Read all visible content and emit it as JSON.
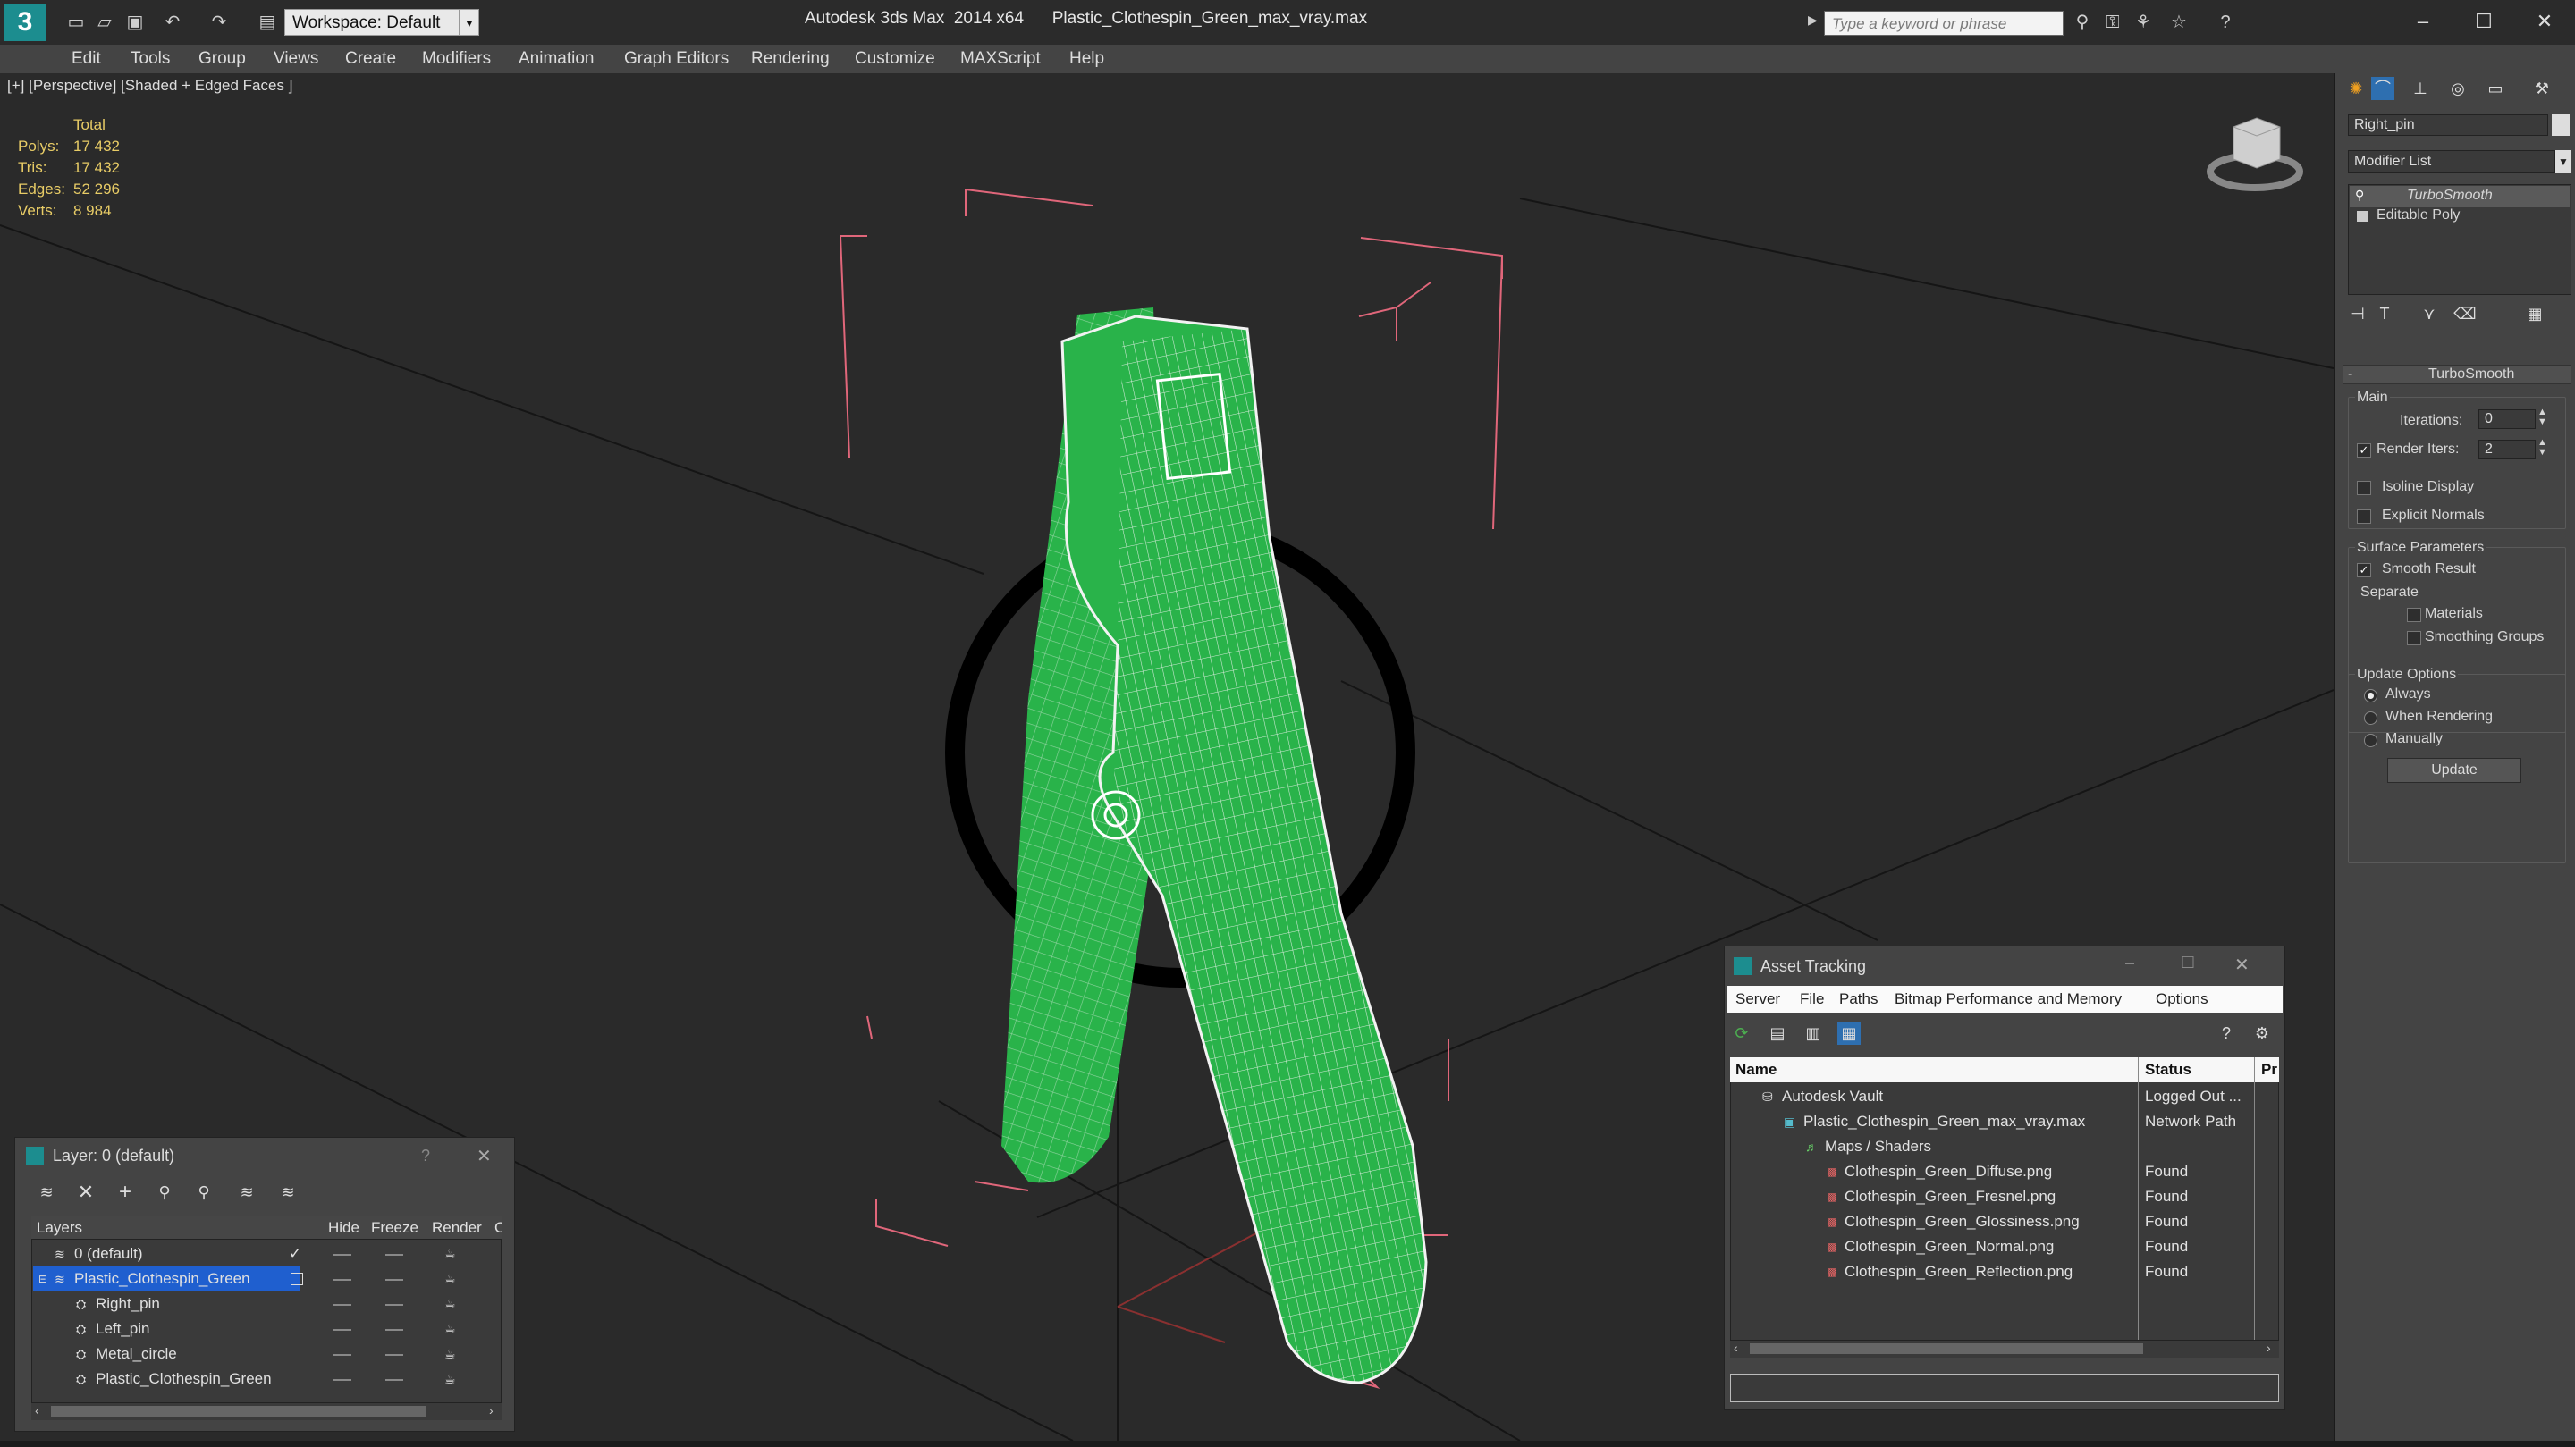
{
  "app": {
    "title": "Autodesk 3ds Max  2014 x64      Plastic_Clothespin_Green_max_vray.max",
    "workspace": "Workspace: Default",
    "search_placeholder": "Type a keyword or phrase"
  },
  "menu": [
    "Edit",
    "Tools",
    "Group",
    "Views",
    "Create",
    "Modifiers",
    "Animation",
    "Graph Editors",
    "Rendering",
    "Customize",
    "MAXScript",
    "Help"
  ],
  "viewport": {
    "label": "[+] [Perspective] [Shaded + Edged Faces ]",
    "stats_header": "Total",
    "stats": [
      {
        "label": "Polys:",
        "value": "17 432"
      },
      {
        "label": "Tris:",
        "value": "17 432"
      },
      {
        "label": "Edges:",
        "value": "52 296"
      },
      {
        "label": "Verts:",
        "value": "8 984"
      }
    ]
  },
  "command_panel": {
    "object_name": "Right_pin",
    "modifier_list": "Modifier List",
    "stack": [
      "TurboSmooth",
      "Editable Poly"
    ],
    "rollout_title": "TurboSmooth",
    "main_label": "Main",
    "iterations_label": "Iterations:",
    "iterations_value": "0",
    "render_iters_label": "Render Iters:",
    "render_iters_value": "2",
    "isoline_label": "Isoline Display",
    "explicit_label": "Explicit Normals",
    "surface_label": "Surface Parameters",
    "smooth_label": "Smooth Result",
    "separate_label": "Separate",
    "materials_label": "Materials",
    "smoothing_label": "Smoothing Groups",
    "update_options_label": "Update Options",
    "always_label": "Always",
    "when_rendering_label": "When Rendering",
    "manually_label": "Manually",
    "update_button": "Update"
  },
  "layer_window": {
    "title": "Layer: 0 (default)",
    "help": "?",
    "columns": [
      "Layers",
      "Hide",
      "Freeze",
      "Render",
      "Co"
    ],
    "rows": [
      {
        "name": "0 (default)",
        "indent": 1,
        "selected": false
      },
      {
        "name": "Plastic_Clothespin_Green",
        "indent": 1,
        "selected": true
      },
      {
        "name": "Right_pin",
        "indent": 2,
        "selected": false
      },
      {
        "name": "Left_pin",
        "indent": 2,
        "selected": false
      },
      {
        "name": "Metal_circle",
        "indent": 2,
        "selected": false
      },
      {
        "name": "Plastic_Clothespin_Green",
        "indent": 2,
        "selected": false
      }
    ]
  },
  "asset_window": {
    "title": "Asset Tracking",
    "menu": [
      "Server",
      "File",
      "Paths",
      "Bitmap Performance and Memory",
      "Options"
    ],
    "columns": [
      "Name",
      "Status",
      "Pr"
    ],
    "rows": [
      {
        "name": "Autodesk Vault",
        "status": "Logged Out ...",
        "indent": 1
      },
      {
        "name": "Plastic_Clothespin_Green_max_vray.max",
        "status": "Network Path",
        "indent": 2
      },
      {
        "name": "Maps / Shaders",
        "status": "",
        "indent": 3
      },
      {
        "name": "Clothespin_Green_Diffuse.png",
        "status": "Found",
        "indent": 4
      },
      {
        "name": "Clothespin_Green_Fresnel.png",
        "status": "Found",
        "indent": 4
      },
      {
        "name": "Clothespin_Green_Glossiness.png",
        "status": "Found",
        "indent": 4
      },
      {
        "name": "Clothespin_Green_Normal.png",
        "status": "Found",
        "indent": 4
      },
      {
        "name": "Clothespin_Green_Reflection.png",
        "status": "Found",
        "indent": 4
      }
    ]
  },
  "colors": {
    "selection": "#1f5fcf",
    "model_green": "#29b34a",
    "wire_white": "#f2f2f2",
    "bbox_pink": "#e0667a",
    "stat_yellow": "#e8cc66"
  }
}
